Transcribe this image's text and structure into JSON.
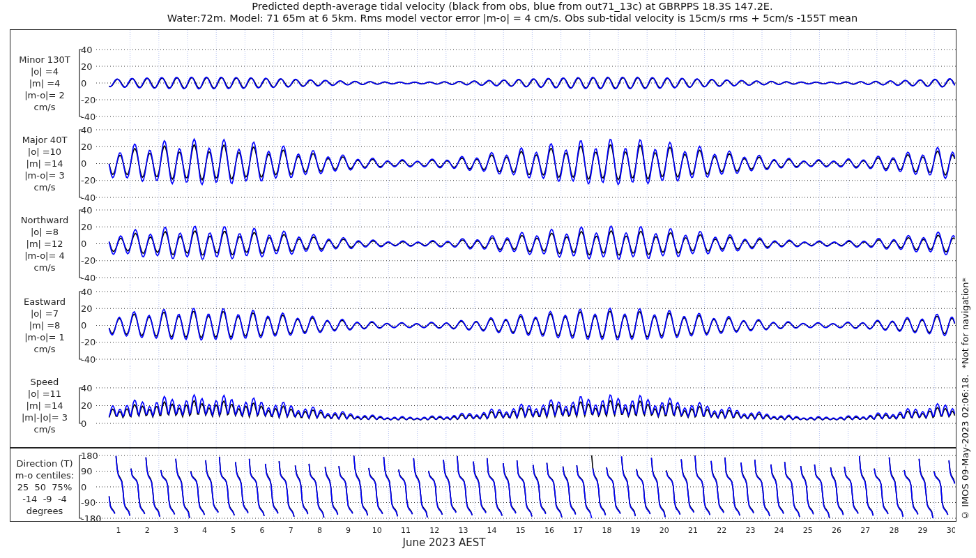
{
  "title_lines": [
    "Predicted depth-average tidal velocity (black from obs, blue from out71_13c) at GBRPPS 18.3S 147.2E.",
    "Water:72m. Model: 71 65m at 6 5km. Rms model vector error |m-o| = 4 cm/s. Obs sub-tidal velocity is 15cm/s rms + 5cm/s -155T mean"
  ],
  "panels": [
    {
      "kind": "minor",
      "label_lines": [
        "Minor 130T",
        "|o| =4",
        "|m| =4",
        "|m-o|= 2",
        "cm/s"
      ],
      "yticks": [
        "40",
        "20",
        "0",
        "-20",
        "-40"
      ]
    },
    {
      "kind": "major",
      "label_lines": [
        "Major 40T",
        "|o| =10",
        "|m| =14",
        "|m-o|= 3",
        "cm/s"
      ],
      "yticks": [
        "40",
        "20",
        "0",
        "-20",
        "-40"
      ]
    },
    {
      "kind": "north",
      "label_lines": [
        "Northward",
        "|o| =8",
        "|m| =12",
        "|m-o|= 4",
        "cm/s"
      ],
      "yticks": [
        "40",
        "20",
        "0",
        "-20",
        "-40"
      ]
    },
    {
      "kind": "east",
      "label_lines": [
        "Eastward",
        "|o| =7",
        "|m| =8",
        "|m-o|= 1",
        "cm/s"
      ],
      "yticks": [
        "40",
        "20",
        "0",
        "-20",
        "-40"
      ]
    },
    {
      "kind": "speed",
      "label_lines": [
        "Speed",
        "|o| =11",
        "|m| =14",
        "|m|-|o|= 3",
        "cm/s"
      ],
      "yticks": [
        "40",
        "20",
        "0"
      ]
    },
    {
      "kind": "direction",
      "label_lines": [
        "Direction (T)",
        "m-o centiles:",
        "25  50  75%",
        "-14  -9  -4",
        "degrees"
      ],
      "yticks": [
        "180",
        "90",
        "0",
        "-90",
        "-180"
      ]
    }
  ],
  "x_axis": {
    "ticks": [
      "1",
      "2",
      "3",
      "4",
      "5",
      "6",
      "7",
      "8",
      "9",
      "10",
      "11",
      "12",
      "13",
      "14",
      "15",
      "16",
      "17",
      "18",
      "19",
      "20",
      "21",
      "22",
      "23",
      "24",
      "25",
      "26",
      "27",
      "28",
      "29",
      "30"
    ],
    "label": "June 2023 AEST"
  },
  "footer_note": "© IMOS 09-May-2023 02:06:18.  *Not for navigation*"
}
